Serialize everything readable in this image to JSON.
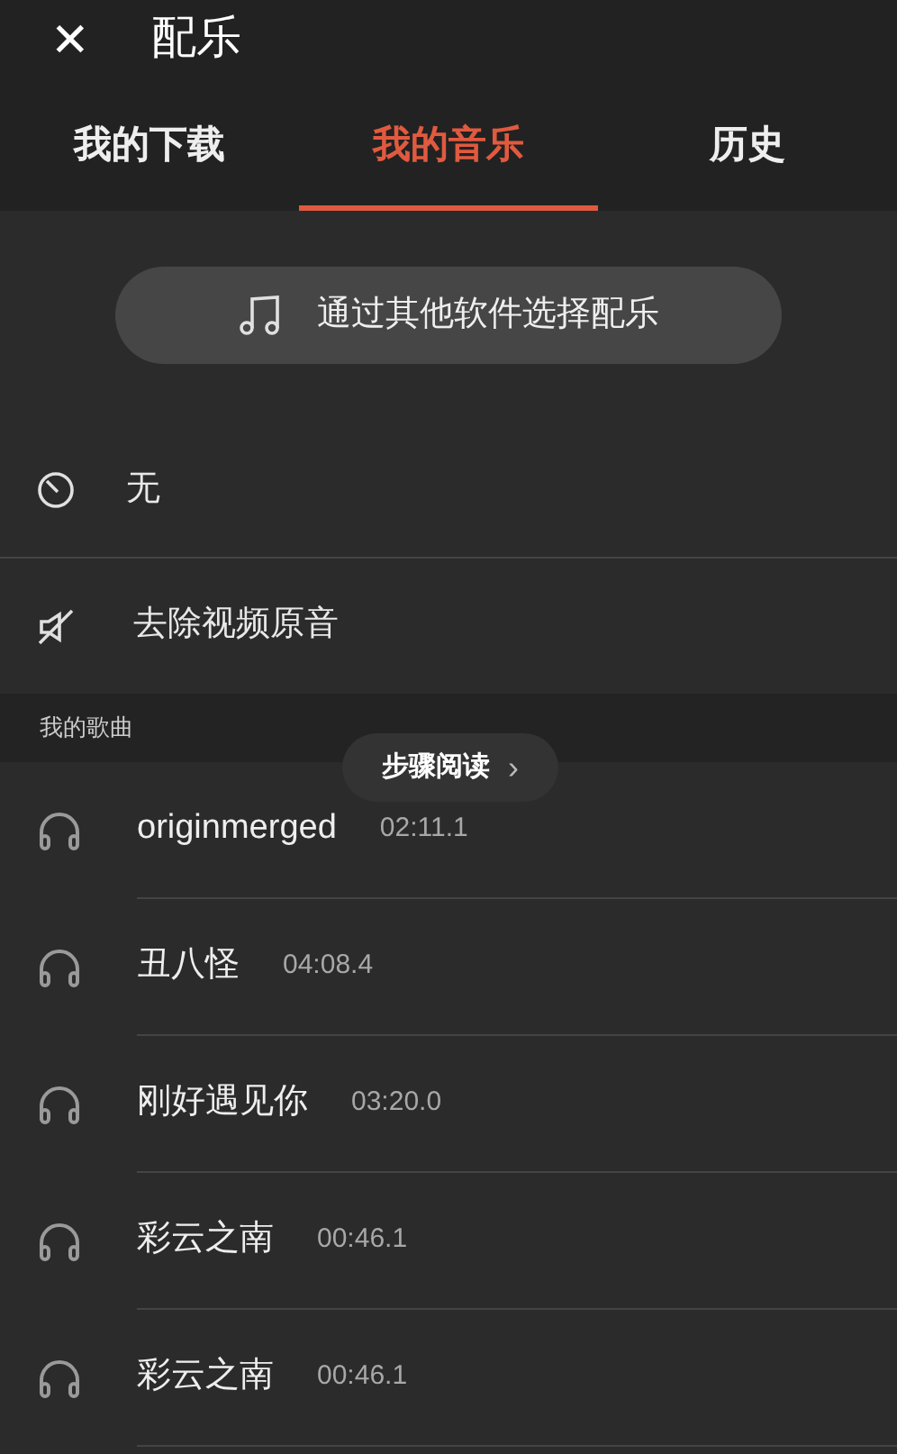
{
  "header": {
    "close": "✕",
    "title": "配乐"
  },
  "tabs": [
    {
      "label": "我的下载",
      "selected": false
    },
    {
      "label": "我的音乐",
      "selected": true
    },
    {
      "label": "历史",
      "selected": false
    }
  ],
  "pick_button": {
    "label": "通过其他软件选择配乐"
  },
  "options": [
    {
      "kind": "none",
      "label": "无"
    },
    {
      "kind": "mute",
      "label": "去除视频原音"
    }
  ],
  "section": {
    "title": "我的歌曲"
  },
  "songs": [
    {
      "title": "originmerged",
      "duration": "02:11.1"
    },
    {
      "title": "丑八怪",
      "duration": "04:08.4"
    },
    {
      "title": "刚好遇见你",
      "duration": "03:20.0"
    },
    {
      "title": "彩云之南",
      "duration": "00:46.1"
    },
    {
      "title": "彩云之南",
      "duration": "00:46.1"
    }
  ],
  "overlay_button": {
    "label": "步骤阅读",
    "arrow": "›"
  }
}
